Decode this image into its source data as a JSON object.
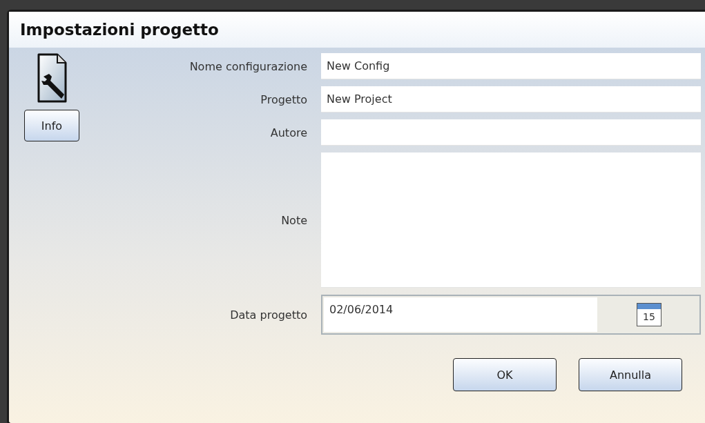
{
  "window": {
    "title": "Impostazioni progetto"
  },
  "info_button": {
    "label": "Info"
  },
  "fields": [
    {
      "kind": "text",
      "label": "Nome configurazione",
      "value": "New Config"
    },
    {
      "kind": "text",
      "label": "Progetto",
      "value": "New Project"
    },
    {
      "kind": "text",
      "label": "Autore"
    },
    {
      "kind": "textarea",
      "label": "Note"
    },
    {
      "kind": "date",
      "label": "Data progetto",
      "value": "02/06/2014",
      "calendar_day": "15"
    }
  ],
  "buttons": [
    "OK",
    "Annulla"
  ]
}
